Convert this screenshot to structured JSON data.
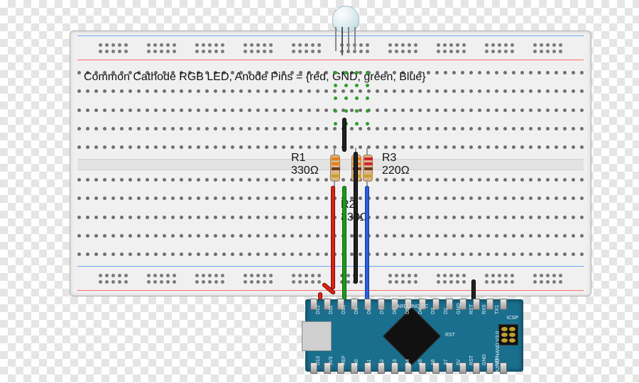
{
  "title_label": "Common Cathode RGB LED, Anode Pins = {red, GND, green, Blue}",
  "components": {
    "led": {
      "type": "RGB LED",
      "cathode": "common",
      "pins": [
        "red",
        "GND",
        "green",
        "blue"
      ]
    },
    "resistors": {
      "R1": {
        "name": "R1",
        "value": "330Ω",
        "bands": [
          "orange",
          "orange",
          "brown",
          "gold"
        ]
      },
      "R2": {
        "name": "R2",
        "value": "330Ω",
        "bands": [
          "orange",
          "orange",
          "brown",
          "gold"
        ]
      },
      "R3": {
        "name": "R3",
        "value": "220Ω",
        "bands": [
          "red",
          "red",
          "brown",
          "gold"
        ]
      }
    }
  },
  "board": {
    "name": "Arduino Nano",
    "brand_text": "ARDUINO.CC",
    "version_text": "ARDUINO NANO V3.0",
    "icsp_label": "ICSP",
    "rst_label": "RST",
    "pins_top": [
      "D13",
      "3V3",
      "REF",
      "A0",
      "A1",
      "A2",
      "A3",
      "A4",
      "A5",
      "A6",
      "A7",
      "5V",
      "RST",
      "GND",
      "VIN"
    ],
    "pins_bot": [
      "D12",
      "D11",
      "D10",
      "D9",
      "D8",
      "D7",
      "D6",
      "D5",
      "D4",
      "D3",
      "D2",
      "GND",
      "RST",
      "RX0",
      "TX1"
    ]
  },
  "wires": [
    {
      "color": "red",
      "from": "D11",
      "to": "R1 / LED red anode"
    },
    {
      "color": "green",
      "from": "D10",
      "to": "R2 / LED green anode"
    },
    {
      "color": "blue",
      "from": "D9",
      "to": "R3 / LED blue anode"
    },
    {
      "color": "black",
      "from": "GND (top rail)",
      "to": "LED common cathode"
    },
    {
      "color": "black",
      "from": "Nano GND",
      "to": "breadboard GND rail"
    }
  ],
  "labels": {
    "R1_line1": "R1",
    "R1_line2": "330Ω",
    "R2_line1": "R2",
    "R2_line2": "330Ω",
    "R3_line1": "R3",
    "R3_line2": "220Ω"
  }
}
